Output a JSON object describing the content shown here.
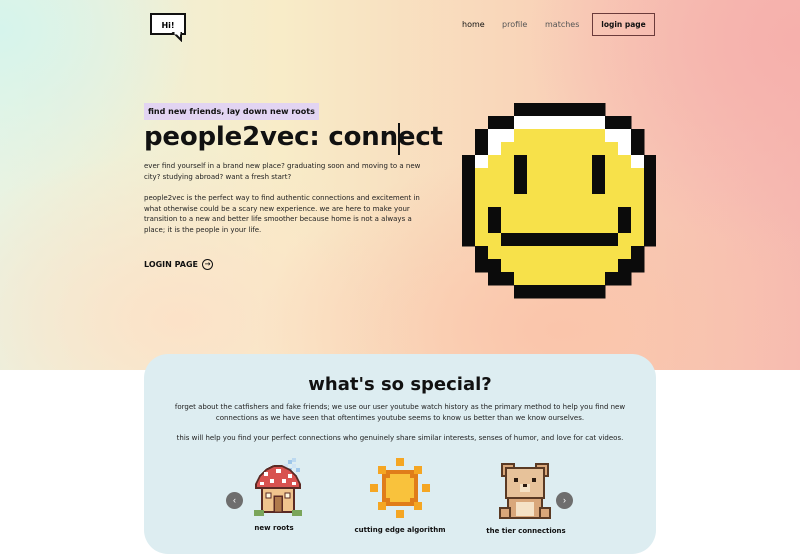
{
  "nav": {
    "logo_text": "Hi!",
    "links": [
      "home",
      "profile",
      "matches"
    ],
    "login_button": "login page"
  },
  "hero": {
    "tagline": "find new friends, lay down new roots",
    "title": "people2vec: connect",
    "paragraph1": "ever find yourself in a brand new place? graduating soon and moving to a new city? studying abroad? want a fresh start?",
    "paragraph2": "people2vec is the perfect way to find authentic connections and excitement in what otherwise could be a scary new experience. we are here to make your transition to a new and better life smoother because home is not a always a place; it is the people in your life.",
    "cta": "LOGIN PAGE",
    "cta_icon": "arrow-right-circle-icon",
    "image": "pixel-smiley-face"
  },
  "special": {
    "title": "what's so special?",
    "text1": "forget about the catfishers and fake friends; we use our user youtube watch history as the primary method to help you find new connections as we have seen that oftentimes youtube seems to know us better than we know ourselves.",
    "text2": "this will help you find your perfect connections who genuinely share similar interests, senses of humor, and love for cat videos.",
    "prev_icon": "chevron-left-icon",
    "next_icon": "chevron-right-icon",
    "cards": [
      {
        "label": "new roots",
        "image": "pixel-mushroom-house"
      },
      {
        "label": "cutting edge algorithm",
        "image": "pixel-sun"
      },
      {
        "label": "the tier connections",
        "image": "pixel-teddy-bear"
      }
    ]
  },
  "colors": {
    "smiley_yellow": "#f7e14a",
    "tag_bg": "#e2d4f2",
    "panel_bg": "#ddedf1",
    "login_border": "#6b3b3b"
  }
}
